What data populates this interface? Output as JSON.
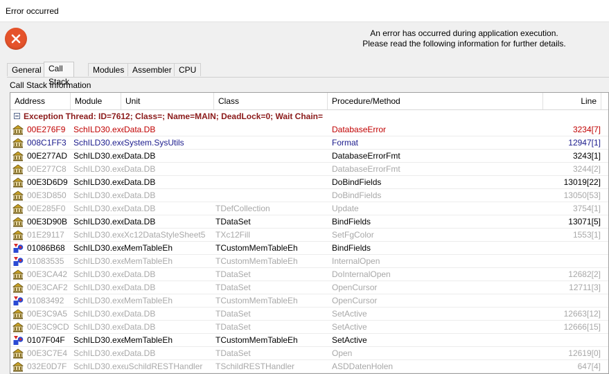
{
  "window": {
    "title": "Error occurred"
  },
  "message": {
    "line1": "An error has occurred during application execution.",
    "line2": "Please read the following information for further details."
  },
  "tabs": [
    {
      "label": "General",
      "active": false
    },
    {
      "label": "Call Stack",
      "active": true
    },
    {
      "label": "Modules",
      "active": false
    },
    {
      "label": "Assembler",
      "active": false
    },
    {
      "label": "CPU",
      "active": false
    }
  ],
  "section_label": "Call Stack Information",
  "columns": [
    "Address",
    "Module",
    "Unit",
    "Class",
    "Procedure/Method",
    "Line"
  ],
  "group_row": "Exception Thread: ID=7612; Class=; Name=MAIN; DeadLock=0; Wait Chain=",
  "rows": [
    {
      "address": "00E276F9",
      "module": "SchILD30.exe",
      "unit": "Data.DB",
      "class": "",
      "proc": "DatabaseError",
      "line": "3234[7]",
      "style": "red",
      "icon": "building"
    },
    {
      "address": "008C1FF3",
      "module": "SchILD30.exe",
      "unit": "System.SysUtils",
      "class": "",
      "proc": "Format",
      "line": "12947[1]",
      "style": "blue",
      "icon": "building"
    },
    {
      "address": "00E277AD",
      "module": "SchILD30.exe",
      "unit": "Data.DB",
      "class": "",
      "proc": "DatabaseErrorFmt",
      "line": "3243[1]",
      "style": "black",
      "icon": "building"
    },
    {
      "address": "00E277C8",
      "module": "SchILD30.exe",
      "unit": "Data.DB",
      "class": "",
      "proc": "DatabaseErrorFmt",
      "line": "3244[2]",
      "style": "gray",
      "icon": "building"
    },
    {
      "address": "00E3D6D9",
      "module": "SchILD30.exe",
      "unit": "Data.DB",
      "class": "",
      "proc": "DoBindFields",
      "line": "13019[22]",
      "style": "black",
      "icon": "building"
    },
    {
      "address": "00E3D850",
      "module": "SchILD30.exe",
      "unit": "Data.DB",
      "class": "",
      "proc": "DoBindFields",
      "line": "13050[53]",
      "style": "gray",
      "icon": "building"
    },
    {
      "address": "00E285F0",
      "module": "SchILD30.exe",
      "unit": "Data.DB",
      "class": "TDefCollection",
      "proc": "Update",
      "line": "3754[1]",
      "style": "gray",
      "icon": "building"
    },
    {
      "address": "00E3D90B",
      "module": "SchILD30.exe",
      "unit": "Data.DB",
      "class": "TDataSet",
      "proc": "BindFields",
      "line": "13071[5]",
      "style": "black",
      "icon": "building"
    },
    {
      "address": "01E29117",
      "module": "SchILD30.exe",
      "unit": "Xc12DataStyleSheet5",
      "class": "TXc12Fill",
      "proc": "SetFgColor",
      "line": "1553[1]",
      "style": "gray",
      "icon": "building"
    },
    {
      "address": "01086B68",
      "module": "SchILD30.exe",
      "unit": "MemTableEh",
      "class": "TCustomMemTableEh",
      "proc": "BindFields",
      "line": "",
      "style": "black",
      "icon": "shapes"
    },
    {
      "address": "01083535",
      "module": "SchILD30.exe",
      "unit": "MemTableEh",
      "class": "TCustomMemTableEh",
      "proc": "InternalOpen",
      "line": "",
      "style": "gray",
      "icon": "shapes"
    },
    {
      "address": "00E3CA42",
      "module": "SchILD30.exe",
      "unit": "Data.DB",
      "class": "TDataSet",
      "proc": "DoInternalOpen",
      "line": "12682[2]",
      "style": "gray",
      "icon": "building"
    },
    {
      "address": "00E3CAF2",
      "module": "SchILD30.exe",
      "unit": "Data.DB",
      "class": "TDataSet",
      "proc": "OpenCursor",
      "line": "12711[3]",
      "style": "gray",
      "icon": "building"
    },
    {
      "address": "01083492",
      "module": "SchILD30.exe",
      "unit": "MemTableEh",
      "class": "TCustomMemTableEh",
      "proc": "OpenCursor",
      "line": "",
      "style": "gray",
      "icon": "shapes"
    },
    {
      "address": "00E3C9A5",
      "module": "SchILD30.exe",
      "unit": "Data.DB",
      "class": "TDataSet",
      "proc": "SetActive",
      "line": "12663[12]",
      "style": "gray",
      "icon": "building"
    },
    {
      "address": "00E3C9CD",
      "module": "SchILD30.exe",
      "unit": "Data.DB",
      "class": "TDataSet",
      "proc": "SetActive",
      "line": "12666[15]",
      "style": "gray",
      "icon": "building"
    },
    {
      "address": "0107F04F",
      "module": "SchILD30.exe",
      "unit": "MemTableEh",
      "class": "TCustomMemTableEh",
      "proc": "SetActive",
      "line": "",
      "style": "black",
      "icon": "shapes"
    },
    {
      "address": "00E3C7E4",
      "module": "SchILD30.exe",
      "unit": "Data.DB",
      "class": "TDataSet",
      "proc": "Open",
      "line": "12619[0]",
      "style": "gray",
      "icon": "building"
    },
    {
      "address": "032E0D7F",
      "module": "SchILD30.exe",
      "unit": "uSchildRESTHandler",
      "class": "TSchildRESTHandler",
      "proc": "ASDDatenHolen",
      "line": "647[4]",
      "style": "gray",
      "icon": "building"
    }
  ],
  "colors": {
    "error_icon": "#e5532b",
    "row_red": "#c00000",
    "row_blue": "#1a1a8c",
    "row_gray": "#a8a8a8",
    "group_text": "#8b1a1a"
  }
}
